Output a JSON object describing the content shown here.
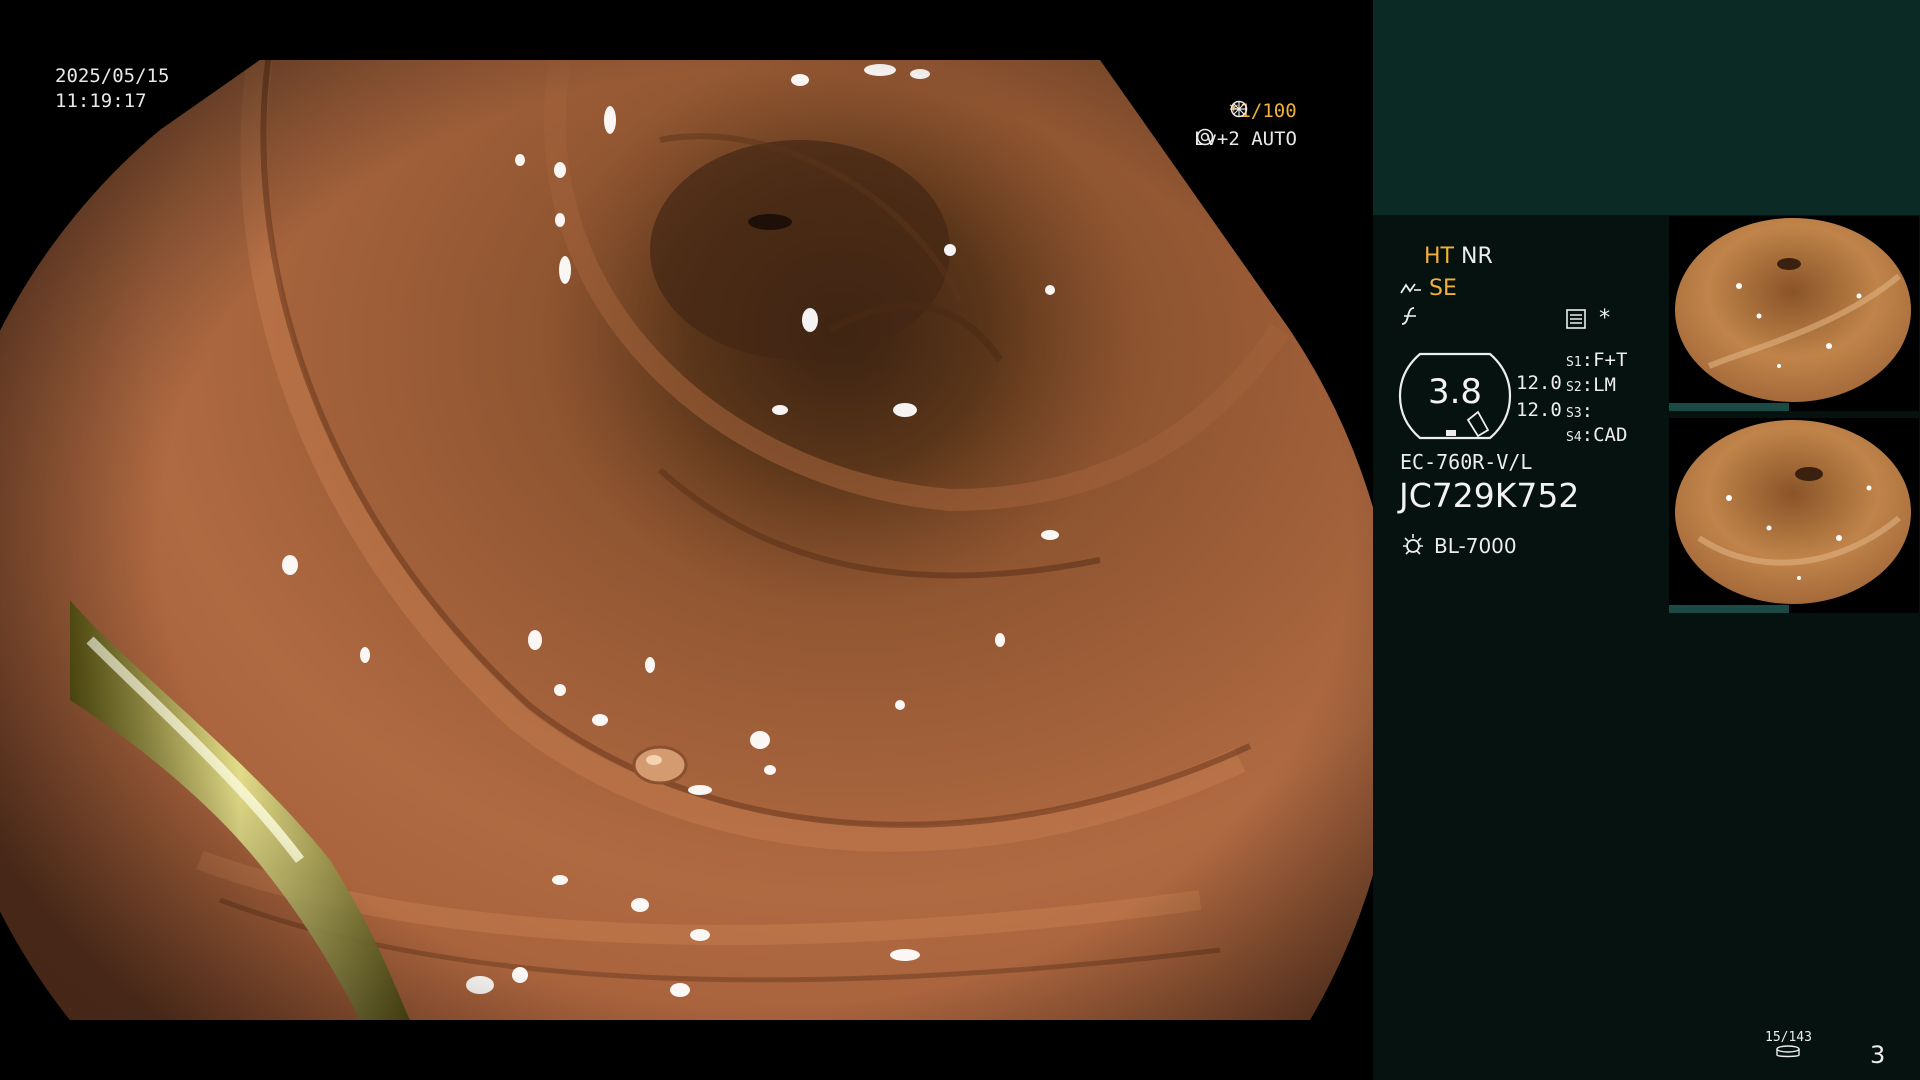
{
  "overlay": {
    "date": "2025/05/15",
    "time": "11:19:17",
    "shutter": "*1/100",
    "level": "Lv+2 AUTO"
  },
  "panel": {
    "mode_ht": "HT",
    "mode_nr": "NR",
    "mode_se": "SE",
    "star": "*",
    "gauge_value": "3.8",
    "value_1": "12.0",
    "value_2": "12.0",
    "s1_label": "S1",
    "s1_value": "F+T",
    "s2_label": "S2",
    "s2_value": "LM",
    "s3_label": "S3",
    "s3_value": "",
    "s4_label": "S4",
    "s4_value": "CAD",
    "scope_model": "EC-760R-V/L",
    "scope_serial": "JC729K752",
    "light_source": "BL-7000",
    "capture_counter": "15/143",
    "page_number": "3"
  },
  "colors": {
    "accent": "#f0b03a",
    "panel_bg": "#051210",
    "panel_top": "#0b2925"
  },
  "icons": [
    "freeze-icon",
    "auto-icon",
    "structure-enhance-icon",
    "color-tone-icon",
    "menu-icon",
    "light-source-icon",
    "disk-icon"
  ]
}
